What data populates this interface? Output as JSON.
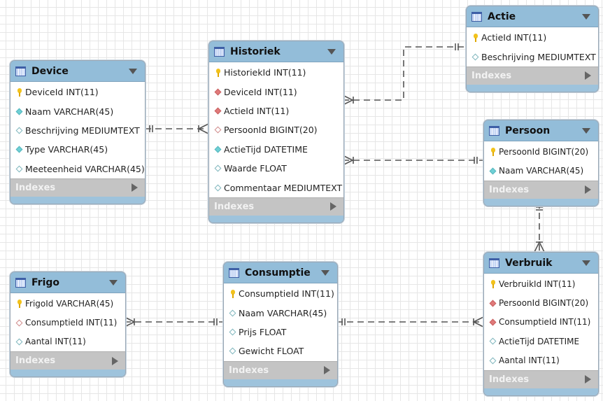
{
  "tables": [
    {
      "id": "device",
      "name": "Device",
      "indexes_label": "Indexes",
      "columns": [
        {
          "text": "DeviceId INT(11)",
          "icon": "key"
        },
        {
          "text": "Naam VARCHAR(45)",
          "icon": "nn"
        },
        {
          "text": "Beschrijving MEDIUMTEXT",
          "icon": "null"
        },
        {
          "text": "Type VARCHAR(45)",
          "icon": "nn"
        },
        {
          "text": "Meeteenheid VARCHAR(45)",
          "icon": "null"
        }
      ]
    },
    {
      "id": "historiek",
      "name": "Historiek",
      "indexes_label": "Indexes",
      "columns": [
        {
          "text": "HistoriekId INT(11)",
          "icon": "key"
        },
        {
          "text": "DeviceId INT(11)",
          "icon": "fk"
        },
        {
          "text": "ActieId INT(11)",
          "icon": "fk"
        },
        {
          "text": "PersoonId BIGINT(20)",
          "icon": "fknull"
        },
        {
          "text": "ActieTijd DATETIME",
          "icon": "nn"
        },
        {
          "text": "Waarde FLOAT",
          "icon": "null"
        },
        {
          "text": "Commentaar MEDIUMTEXT",
          "icon": "null"
        }
      ]
    },
    {
      "id": "actie",
      "name": "Actie",
      "indexes_label": "Indexes",
      "columns": [
        {
          "text": "ActieId INT(11)",
          "icon": "key"
        },
        {
          "text": "Beschrijving MEDIUMTEXT",
          "icon": "null"
        }
      ]
    },
    {
      "id": "persoon",
      "name": "Persoon",
      "indexes_label": "Indexes",
      "columns": [
        {
          "text": "PersoonId BIGINT(20)",
          "icon": "key"
        },
        {
          "text": "Naam VARCHAR(45)",
          "icon": "nn"
        }
      ]
    },
    {
      "id": "verbruik",
      "name": "Verbruik",
      "indexes_label": "Indexes",
      "columns": [
        {
          "text": "VerbruikId INT(11)",
          "icon": "key"
        },
        {
          "text": "PersoonId BIGINT(20)",
          "icon": "fk"
        },
        {
          "text": "ConsumptieId INT(11)",
          "icon": "fk"
        },
        {
          "text": "ActieTijd DATETIME",
          "icon": "null"
        },
        {
          "text": "Aantal INT(11)",
          "icon": "null"
        }
      ]
    },
    {
      "id": "frigo",
      "name": "Frigo",
      "indexes_label": "Indexes",
      "columns": [
        {
          "text": "FrigoId VARCHAR(45)",
          "icon": "key"
        },
        {
          "text": "ConsumptieId INT(11)",
          "icon": "fknull"
        },
        {
          "text": "Aantal INT(11)",
          "icon": "null"
        }
      ]
    },
    {
      "id": "consumptie",
      "name": "Consumptie",
      "indexes_label": "Indexes",
      "columns": [
        {
          "text": "ConsumptieId INT(11)",
          "icon": "key"
        },
        {
          "text": "Naam VARCHAR(45)",
          "icon": "null"
        },
        {
          "text": "Prijs FLOAT",
          "icon": "null"
        },
        {
          "text": "Gewicht FLOAT",
          "icon": "null"
        }
      ]
    }
  ],
  "relationships": [
    {
      "from": "Device",
      "to": "Historiek",
      "type": "one-to-many"
    },
    {
      "from": "Actie",
      "to": "Historiek",
      "type": "one-to-many"
    },
    {
      "from": "Persoon",
      "to": "Historiek",
      "type": "one-to-many"
    },
    {
      "from": "Persoon",
      "to": "Verbruik",
      "type": "one-to-many"
    },
    {
      "from": "Consumptie",
      "to": "Frigo",
      "type": "one-to-many"
    },
    {
      "from": "Consumptie",
      "to": "Verbruik",
      "type": "one-to-many"
    }
  ],
  "colors": {
    "header": "#93bdd9",
    "indexes": "#c4c4c4",
    "fk": "#e07a7a",
    "notnull": "#6fd0d6",
    "key": "#f2c21b"
  }
}
